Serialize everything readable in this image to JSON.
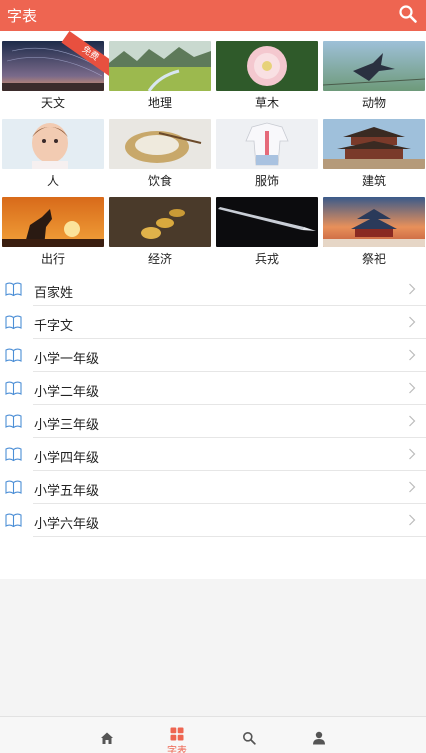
{
  "header": {
    "title": "字表",
    "search_icon": "search-icon"
  },
  "colors": {
    "accent": "#ee6551",
    "icon_blue": "#4d8fd6"
  },
  "categories": [
    {
      "label": "天文",
      "badge": "免费"
    },
    {
      "label": "地理"
    },
    {
      "label": "草木"
    },
    {
      "label": "动物"
    },
    {
      "label": "人"
    },
    {
      "label": "饮食"
    },
    {
      "label": "服饰"
    },
    {
      "label": "建筑"
    },
    {
      "label": "出行"
    },
    {
      "label": "经济"
    },
    {
      "label": "兵戎"
    },
    {
      "label": "祭祀"
    }
  ],
  "list": [
    {
      "label": "百家姓"
    },
    {
      "label": "千字文"
    },
    {
      "label": "小学一年级"
    },
    {
      "label": "小学二年级"
    },
    {
      "label": "小学三年级"
    },
    {
      "label": "小学四年级"
    },
    {
      "label": "小学五年级"
    },
    {
      "label": "小学六年级"
    }
  ],
  "tabbar": [
    {
      "icon": "home-icon",
      "label": ""
    },
    {
      "icon": "grid-icon",
      "label": "字表",
      "active": true
    },
    {
      "icon": "search-icon",
      "label": ""
    },
    {
      "icon": "user-icon",
      "label": ""
    }
  ]
}
